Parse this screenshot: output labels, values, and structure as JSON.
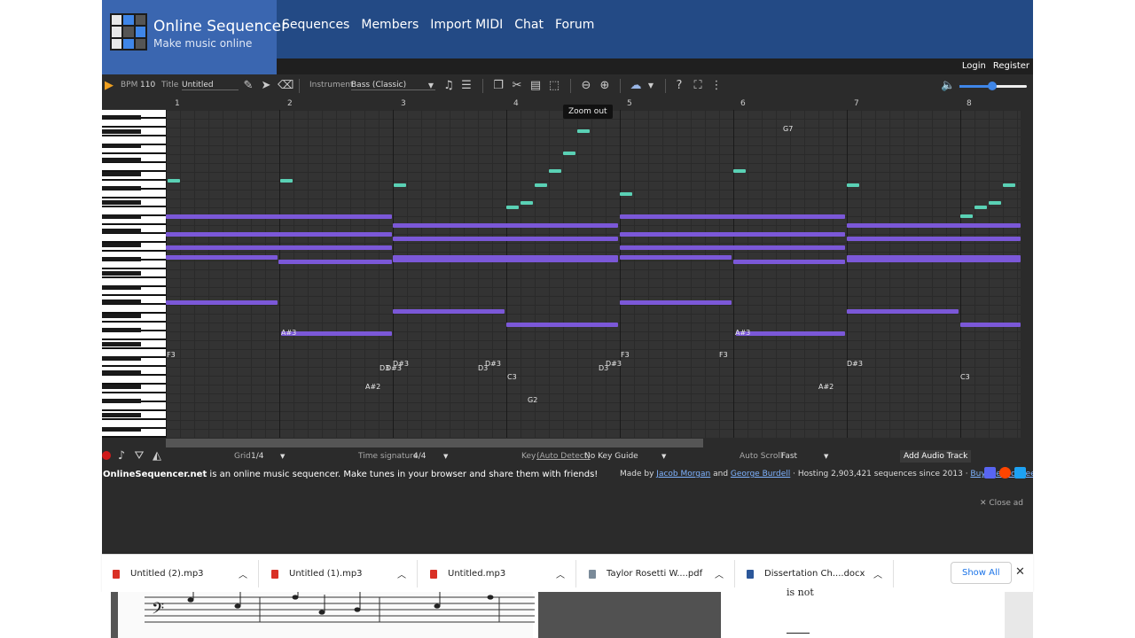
{
  "brand": {
    "title": "Online Sequencer",
    "subtitle": "Make music online"
  },
  "nav": [
    "Sequences",
    "Members",
    "Import MIDI",
    "Chat",
    "Forum"
  ],
  "auth": {
    "login": "Login",
    "register": "Register"
  },
  "toolbar": {
    "bpm_label": "BPM",
    "bpm_value": "110",
    "title_label": "Title",
    "title_value": "Untitled",
    "instrument_label": "Instrument",
    "instrument_value": "Bass (Classic)"
  },
  "tooltip": "Zoom out",
  "measures": [
    "1",
    "2",
    "3",
    "4",
    "5",
    "6",
    "7",
    "8"
  ],
  "note_labels": [
    {
      "text": "G7"
    },
    {
      "text": "A#3"
    },
    {
      "text": "A#3"
    },
    {
      "text": "F3"
    },
    {
      "text": "F3"
    },
    {
      "text": "F3"
    },
    {
      "text": "D#3"
    },
    {
      "text": "D#3"
    },
    {
      "text": "D#3"
    },
    {
      "text": "D#3"
    },
    {
      "text": "D#3"
    },
    {
      "text": "D3"
    },
    {
      "text": "D3"
    },
    {
      "text": "D3"
    },
    {
      "text": "C3"
    },
    {
      "text": "C3"
    },
    {
      "text": "A#2"
    },
    {
      "text": "A#2"
    },
    {
      "text": "G2"
    }
  ],
  "bottombar": {
    "grid_label": "Grid",
    "grid_value": "1/4",
    "ts_label": "Time signature",
    "ts_value": "4/4",
    "key_label": "Key",
    "key_auto": "(Auto Detect)",
    "key_value": "No Key Guide",
    "scroll_label": "Auto Scroll",
    "scroll_value": "Fast",
    "add_track": "Add Audio Track"
  },
  "footer": {
    "site": "OnlineSequencer.net",
    "tagline": " is an online music sequencer. Make tunes in your browser and share them with friends!",
    "made_by": "Made by ",
    "author1": "Jacob Morgan",
    "and": " and ",
    "author2": "George Burdell",
    "hosting": " · Hosting 2,903,421 sequences since 2013 · ",
    "coffee": "Buy me a coffee!"
  },
  "close_ad": "✕ Close ad",
  "downloads": [
    {
      "name": "Untitled (2).mp3",
      "type": "mp3"
    },
    {
      "name": "Untitled (1).mp3",
      "type": "mp3"
    },
    {
      "name": "Untitled.mp3",
      "type": "mp3"
    },
    {
      "name": "Taylor Rosetti W....pdf",
      "type": "pdf"
    },
    {
      "name": "Dissertation Ch....docx",
      "type": "docx"
    }
  ],
  "show_all": "Show All",
  "doc_snippet": "is not",
  "colors": {
    "header": "#234a85",
    "brand": "#3a66b0",
    "note": "#7b58d8",
    "note_high": "#5ad1b5",
    "record": "#d01b1b"
  }
}
